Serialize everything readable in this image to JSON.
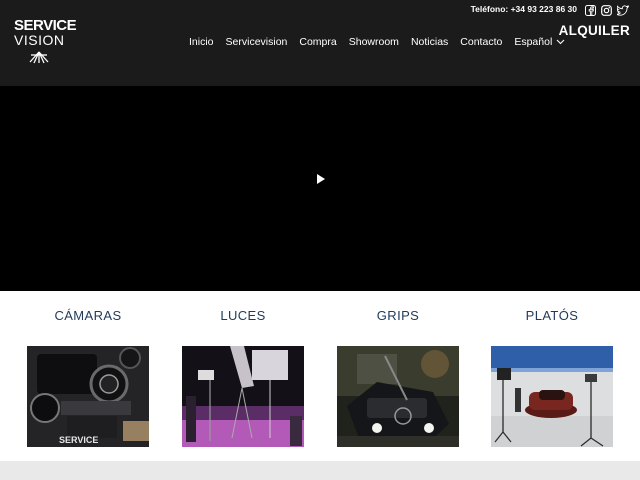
{
  "logo": {
    "line1": "SERVICE",
    "line2": "VISION"
  },
  "topbar": {
    "phone": "Teléfono: +34 93 223 86 30",
    "icons": [
      "facebook-icon",
      "instagram-icon",
      "twitter-icon"
    ]
  },
  "header": {
    "alquiler": "ALQUILER"
  },
  "nav": {
    "items": [
      "Inicio",
      "Servicevision",
      "Compra",
      "Showroom",
      "Noticias",
      "Contacto"
    ],
    "language": "Español"
  },
  "video": {
    "play_icon": "play-icon"
  },
  "categories": [
    {
      "label": "CÁMARAS"
    },
    {
      "label": "LUCES"
    },
    {
      "label": "GRIPS"
    },
    {
      "label": "PLATÓS"
    }
  ],
  "colors": {
    "header_bg": "#1b1b1c",
    "category_text": "#1f3a5a",
    "video_bg": "#000000"
  }
}
